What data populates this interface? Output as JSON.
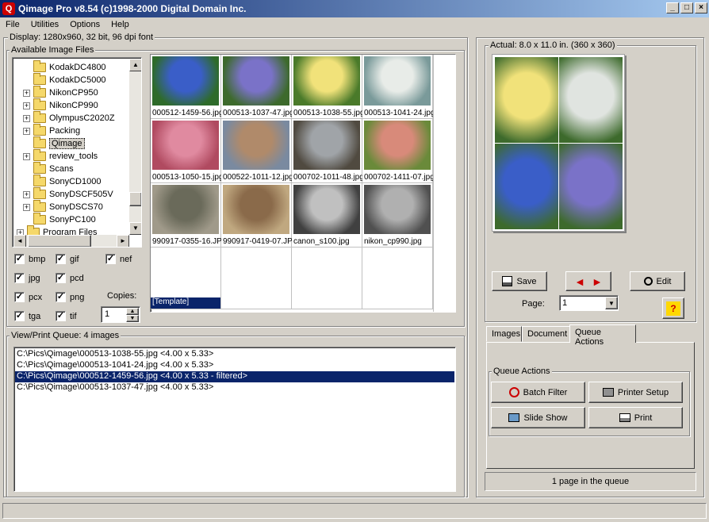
{
  "window": {
    "title": "Qimage Pro v8.54  (c)1998-2000  Digital Domain Inc.",
    "min": "_",
    "max": "□",
    "close": "×"
  },
  "menu": [
    "File",
    "Utilities",
    "Options",
    "Help"
  ],
  "display_info": "Display: 1280x960, 32 bit, 96 dpi font",
  "files_group": "Available Image Files",
  "tree": [
    {
      "label": "KodakDC4800",
      "expander": ""
    },
    {
      "label": "KodakDC5000",
      "expander": ""
    },
    {
      "label": "NikonCP950",
      "expander": "+"
    },
    {
      "label": "NikonCP990",
      "expander": "+"
    },
    {
      "label": "OlympusC2020Z",
      "expander": "+"
    },
    {
      "label": "Packing",
      "expander": "+"
    },
    {
      "label": "Qimage",
      "expander": "",
      "selected": true
    },
    {
      "label": "review_tools",
      "expander": "+"
    },
    {
      "label": "Scans",
      "expander": ""
    },
    {
      "label": "SonyCD1000",
      "expander": ""
    },
    {
      "label": "SonyDSCF505V",
      "expander": "+"
    },
    {
      "label": "SonyDSCS70",
      "expander": "+"
    },
    {
      "label": "SonyPC100",
      "expander": ""
    },
    {
      "label": "Program Files",
      "expander": "+"
    }
  ],
  "thumbs": [
    {
      "caption": "000512-1459-56.jpg",
      "colors": [
        "#3a5ec8",
        "#2e6b2a"
      ]
    },
    {
      "caption": "000513-1037-47.jpg",
      "colors": [
        "#7a72c8",
        "#3d6a2c"
      ]
    },
    {
      "caption": "000513-1038-55.jpg",
      "colors": [
        "#f1e27a",
        "#4a7a2a"
      ]
    },
    {
      "caption": "000513-1041-24.jpg",
      "colors": [
        "#e8ece8",
        "#7a9a9a"
      ]
    },
    {
      "caption": "000513-1050-15.jpg",
      "colors": [
        "#e08aa0",
        "#b04a60"
      ]
    },
    {
      "caption": "000522-1011-12.jpg",
      "colors": [
        "#b08a6a",
        "#7a8aa0"
      ]
    },
    {
      "caption": "000702-1011-48.jpg",
      "colors": [
        "#a0a4a8",
        "#504a40"
      ]
    },
    {
      "caption": "000702-1411-07.jpg",
      "colors": [
        "#d88a7a",
        "#6a8a3a"
      ]
    },
    {
      "caption": "990917-0355-16.JPG",
      "colors": [
        "#6a6a5a",
        "#a09a8a"
      ]
    },
    {
      "caption": "990917-0419-07.JPG",
      "colors": [
        "#8a6a4a",
        "#c0a880"
      ]
    },
    {
      "caption": "canon_s100.jpg",
      "colors": [
        "#c0c0c0",
        "#404040"
      ]
    },
    {
      "caption": "nikon_cp990.jpg",
      "colors": [
        "#b0b0b0",
        "#505050"
      ]
    }
  ],
  "template_label": "[Template]",
  "filters": [
    {
      "label": "bmp",
      "checked": true
    },
    {
      "label": "gif",
      "checked": true
    },
    {
      "label": "nef",
      "checked": true
    },
    {
      "label": "jpg",
      "checked": true
    },
    {
      "label": "pcd",
      "checked": true
    },
    {
      "label": "pcx",
      "checked": true
    },
    {
      "label": "png",
      "checked": true
    },
    {
      "label": "tga",
      "checked": true
    },
    {
      "label": "tif",
      "checked": true
    }
  ],
  "copies": {
    "label": "Copies:",
    "value": "1"
  },
  "queue": {
    "title": "View/Print Queue: 4 images",
    "items": [
      "C:\\Pics\\Qimage\\000513-1038-55.jpg <4.00 x 5.33>",
      "C:\\Pics\\Qimage\\000513-1041-24.jpg <4.00 x 5.33>",
      "C:\\Pics\\Qimage\\000512-1459-56.jpg <4.00 x 5.33 - filtered>",
      "C:\\Pics\\Qimage\\000513-1037-47.jpg <4.00 x 5.33>"
    ],
    "selected_index": 2
  },
  "preview": {
    "actual": "Actual: 8.0 x 11.0 in.  (360 x 360)",
    "quad_colors": [
      "#f1e27a",
      "#e0e4e0",
      "#3a5ec8",
      "#7a72c8"
    ]
  },
  "buttons": {
    "save": "Save",
    "edit": "Edit",
    "help": "?",
    "prev": "◄",
    "next": "►"
  },
  "page": {
    "label": "Page:",
    "value": "1"
  },
  "tabs": [
    "Images",
    "Document",
    "Queue Actions"
  ],
  "active_tab": "Queue Actions",
  "queue_actions": {
    "group": "Queue Actions",
    "batch_filter": "Batch Filter",
    "printer_setup": "Printer Setup",
    "slide_show": "Slide Show",
    "print": "Print"
  },
  "status": "1 page in the queue",
  "colors": {
    "title_start": "#0a246a",
    "title_end": "#a6caf0",
    "selection": "#0a246a"
  }
}
